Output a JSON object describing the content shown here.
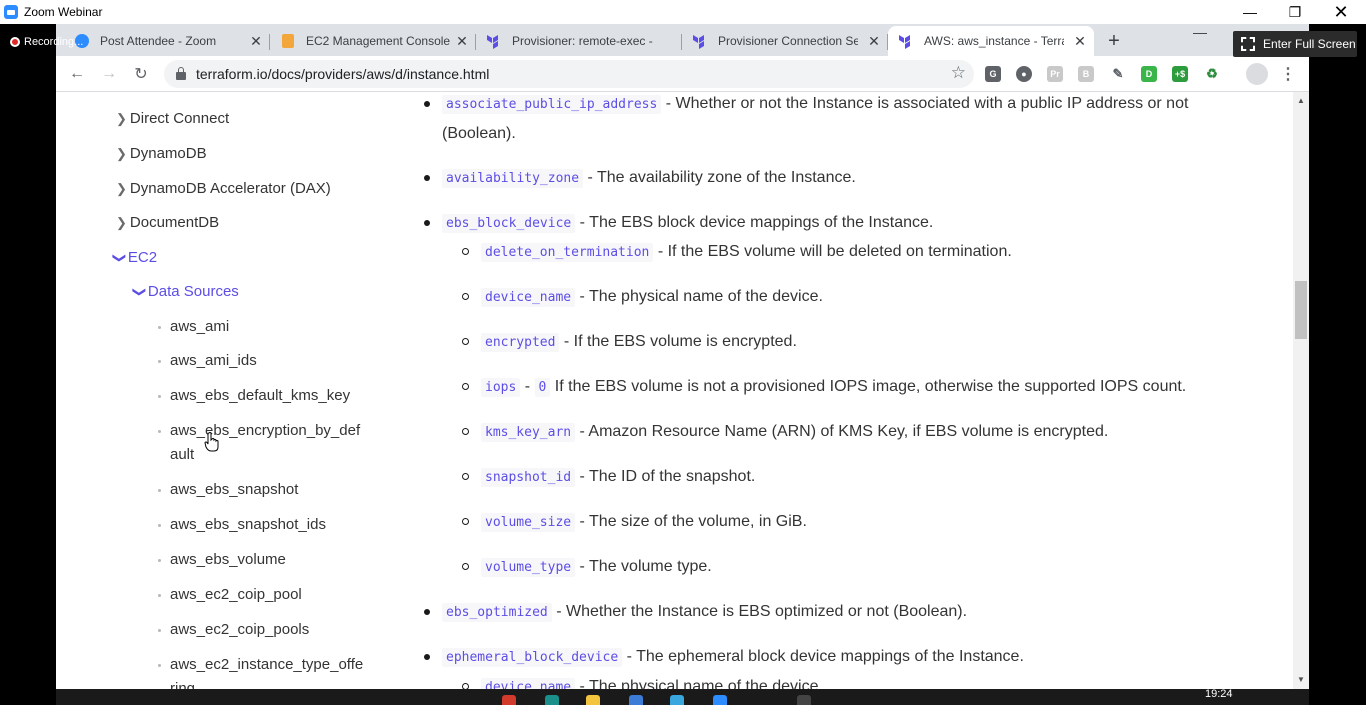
{
  "zoom": {
    "title": "Zoom Webinar",
    "recording_label": "Recording...",
    "fullscreen_label": "Enter Full Screen"
  },
  "browser": {
    "tabs": [
      {
        "title": "Post Attendee - Zoom",
        "icon": "zoom-icon"
      },
      {
        "title": "EC2 Management Console",
        "icon": "aws-icon"
      },
      {
        "title": "Provisioner: remote-exec - ",
        "icon": "terraform-icon"
      },
      {
        "title": "Provisioner Connection Set",
        "icon": "terraform-icon"
      },
      {
        "title": "AWS: aws_instance - Terrafo",
        "icon": "terraform-icon",
        "active": true
      }
    ],
    "url": "terraform.io/docs/providers/aws/d/instance.html",
    "extensions": [
      "G",
      "●",
      "Pr",
      "B",
      "✎",
      "D",
      "+$",
      "♻"
    ]
  },
  "sidebar": {
    "sections": [
      {
        "label": "Direct Connect",
        "expanded": false
      },
      {
        "label": "DynamoDB",
        "expanded": false
      },
      {
        "label": "DynamoDB Accelerator (DAX)",
        "expanded": false
      },
      {
        "label": "DocumentDB",
        "expanded": false
      },
      {
        "label": "EC2",
        "expanded": true
      },
      {
        "label": "Data Sources",
        "expanded": true
      }
    ],
    "leaves": [
      {
        "line1": "aws_ami"
      },
      {
        "line1": "aws_ami_ids"
      },
      {
        "line1": "aws_ebs_default_kms_key"
      },
      {
        "line1": "aws_ebs_encryption_by_def",
        "line2": "ault"
      },
      {
        "line1": "aws_ebs_snapshot"
      },
      {
        "line1": "aws_ebs_snapshot_ids"
      },
      {
        "line1": "aws_ebs_volume"
      },
      {
        "line1": "aws_ec2_coip_pool"
      },
      {
        "line1": "aws_ec2_coip_pools"
      },
      {
        "line1": "aws_ec2_instance_type_offe",
        "line2": "ring"
      }
    ]
  },
  "doc": {
    "items": [
      {
        "code": "associate_public_ip_address",
        "text": " - Whether or not the Instance is associated with a public IP address or not",
        "cont": "(Boolean)."
      },
      {
        "code": "availability_zone",
        "text": " - The availability zone of the Instance."
      },
      {
        "code": "ebs_block_device",
        "text": " - The EBS block device mappings of the Instance."
      },
      {
        "code": "delete_on_termination",
        "text": " - If the EBS volume will be deleted on termination."
      },
      {
        "code": "device_name",
        "text": " - The physical name of the device."
      },
      {
        "code": "encrypted",
        "text": " - If the EBS volume is encrypted."
      },
      {
        "code": "iops",
        "text": " - ",
        "code2": "0",
        "text2": " If the EBS volume is not a provisioned IOPS image, otherwise the supported IOPS count."
      },
      {
        "code": "kms_key_arn",
        "text": " - Amazon Resource Name (ARN) of KMS Key, if EBS volume is encrypted."
      },
      {
        "code": "snapshot_id",
        "text": " - The ID of the snapshot."
      },
      {
        "code": "volume_size",
        "text": " - The size of the volume, in GiB."
      },
      {
        "code": "volume_type",
        "text": " - The volume type."
      },
      {
        "code": "ebs_optimized",
        "text": " - Whether the Instance is EBS optimized or not (Boolean)."
      },
      {
        "code": "ephemeral_block_device",
        "text": " - The ephemeral block device mappings of the Instance."
      },
      {
        "code": "device_name",
        "text": " - The physical name of the device."
      }
    ]
  },
  "taskbar": {
    "time": "19:24"
  }
}
